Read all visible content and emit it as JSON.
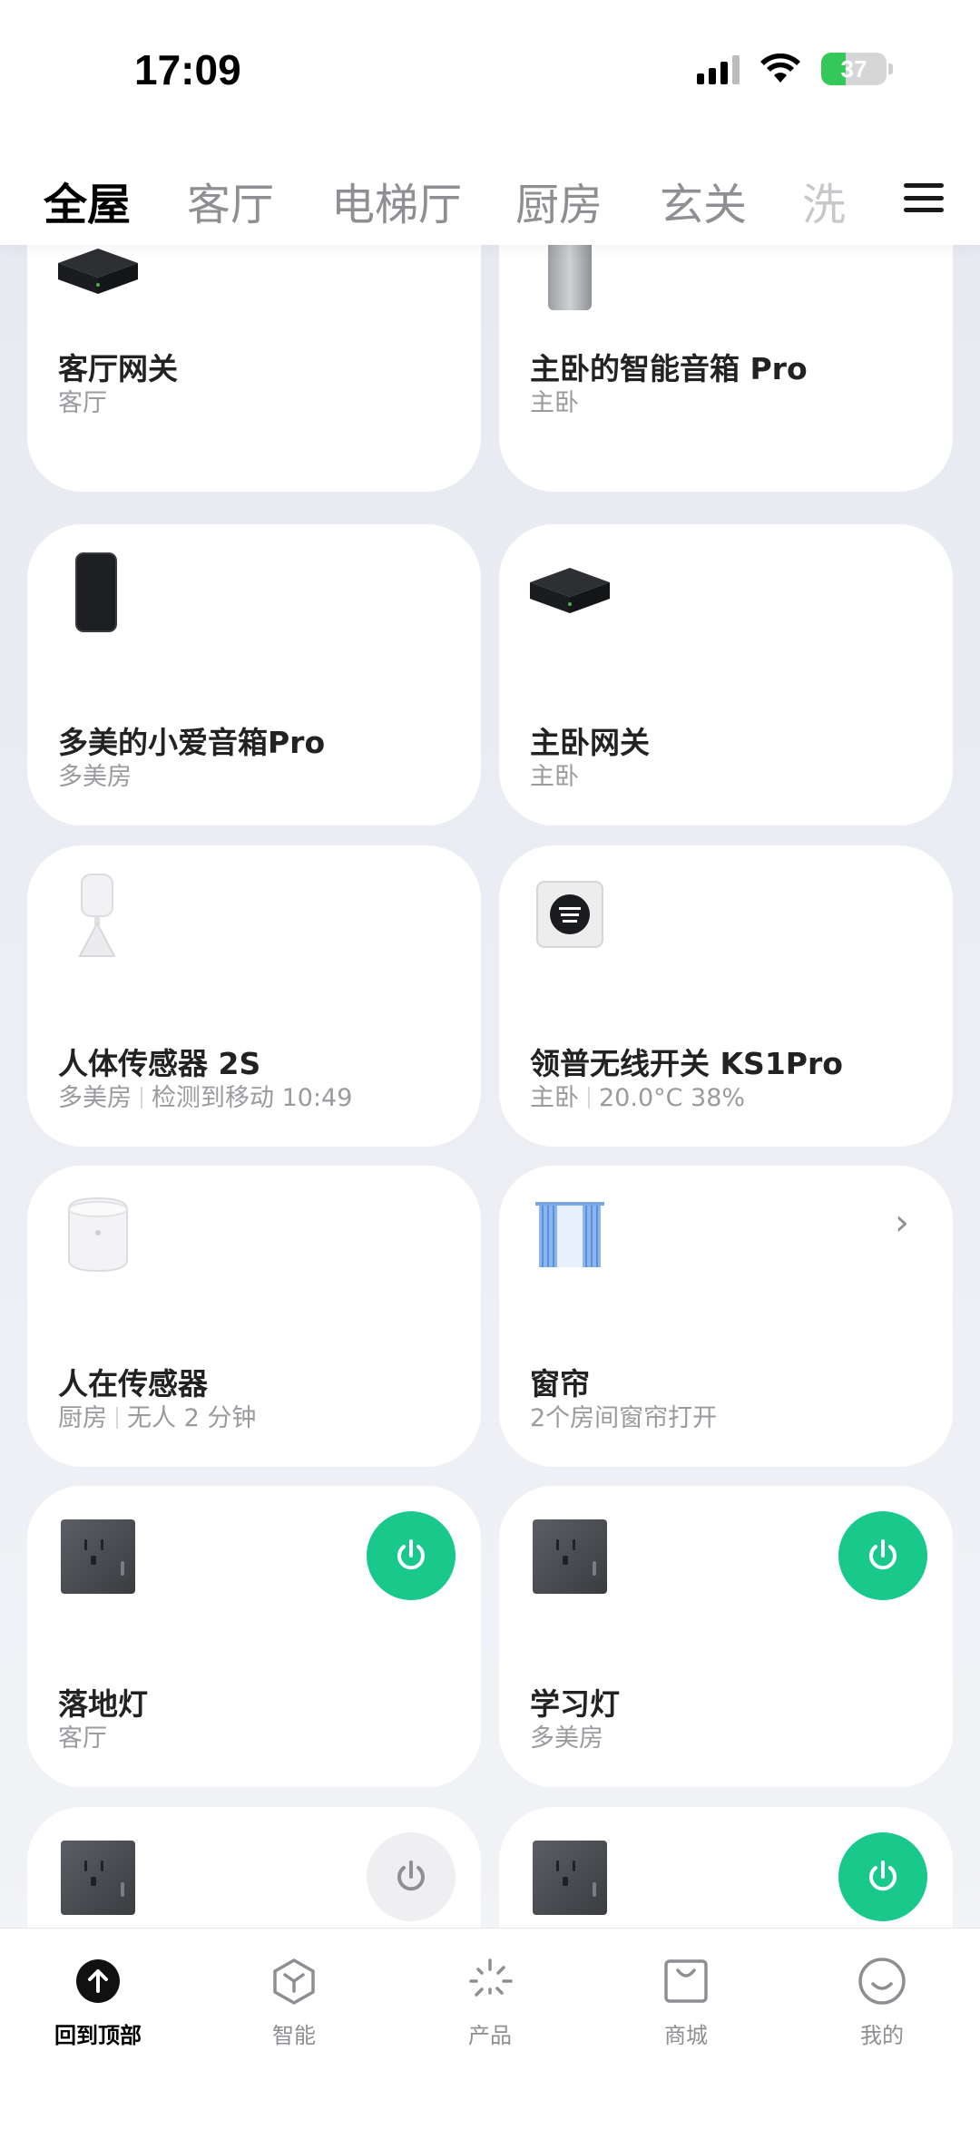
{
  "status_bar": {
    "time": "17:09",
    "battery": "37",
    "battery_level_percent": 37
  },
  "tabs": [
    {
      "label": "全屋",
      "active": true
    },
    {
      "label": "客厅"
    },
    {
      "label": "电梯厅"
    },
    {
      "label": "厨房"
    },
    {
      "label": "玄关"
    },
    {
      "label": "洗"
    }
  ],
  "devices": [
    {
      "name": "客厅网关",
      "room": "客厅",
      "icon": "gateway-icon"
    },
    {
      "name": "主卧的智能音箱 Pro",
      "room": "主卧",
      "icon": "speaker-silver-icon"
    },
    {
      "name": "多美的小爱音箱Pro",
      "room": "多美房",
      "icon": "speaker-black-icon"
    },
    {
      "name": "主卧网关",
      "room": "主卧",
      "icon": "gateway-icon"
    },
    {
      "name": "人体传感器 2S",
      "room": "多美房",
      "status": "检测到移动 10:49",
      "icon": "motion-sensor-icon"
    },
    {
      "name": "领普无线开关 KS1Pro",
      "room": "主卧",
      "status": "20.0°C 38%",
      "icon": "wireless-switch-icon"
    },
    {
      "name": "人在传感器",
      "room": "厨房",
      "status": "无人 2 分钟",
      "icon": "presence-sensor-icon"
    },
    {
      "name": "窗帘",
      "room": "2个房间窗帘打开",
      "icon": "curtain-icon"
    },
    {
      "name": "落地灯",
      "room": "客厅",
      "icon": "socket-icon",
      "power": "on"
    },
    {
      "name": "学习灯",
      "room": "多美房",
      "icon": "socket-icon",
      "power": "on"
    },
    {
      "icon": "socket-icon",
      "power": "off"
    },
    {
      "icon": "socket-icon",
      "power": "on"
    }
  ],
  "bottom_nav": [
    {
      "label": "回到顶部",
      "icon": "arrow-up-icon",
      "active": true
    },
    {
      "label": "智能",
      "icon": "cube-icon"
    },
    {
      "label": "产品",
      "icon": "sparkle-icon"
    },
    {
      "label": "商城",
      "icon": "shopping-bag-icon"
    },
    {
      "label": "我的",
      "icon": "smiley-icon"
    }
  ],
  "colors": {
    "power_on": "#19c98c",
    "power_off": "#efeff2",
    "battery": "#34c759"
  }
}
